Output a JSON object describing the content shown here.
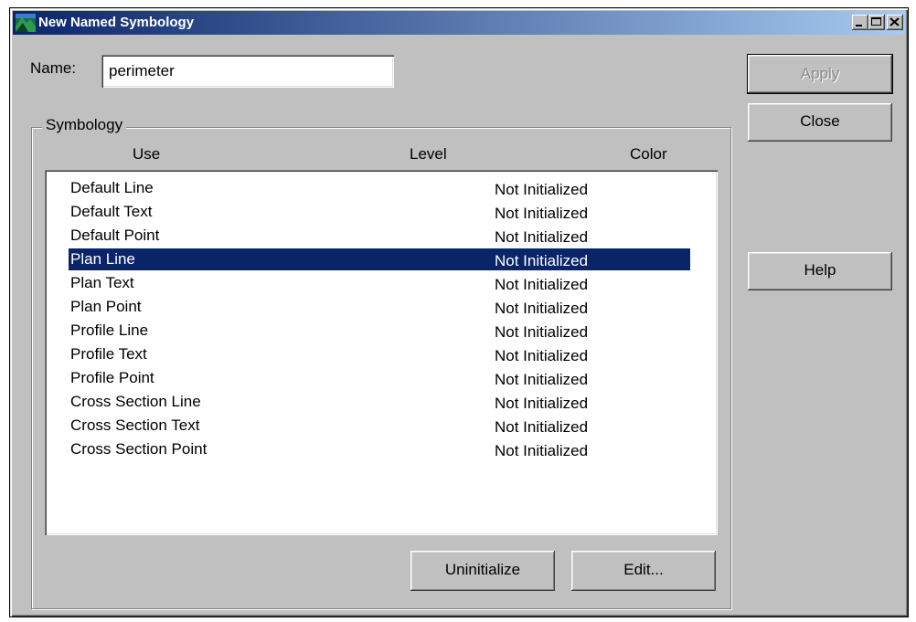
{
  "window": {
    "title": "New Named Symbology"
  },
  "name_field": {
    "label": "Name:",
    "value": "perimeter"
  },
  "buttons": {
    "apply": "Apply",
    "close": "Close",
    "help": "Help",
    "uninitialize": "Uninitialize",
    "edit": "Edit..."
  },
  "symbology": {
    "group_label": "Symbology",
    "columns": {
      "use": "Use",
      "level": "Level",
      "color": "Color"
    },
    "rows": [
      {
        "use": "Default Line",
        "level": "Not Initialized"
      },
      {
        "use": "Default Text",
        "level": "Not Initialized"
      },
      {
        "use": "Default Point",
        "level": "Not Initialized"
      },
      {
        "use": "Plan Line",
        "level": "Not Initialized",
        "selected": true
      },
      {
        "use": "Plan Text",
        "level": "Not Initialized"
      },
      {
        "use": "Plan Point",
        "level": "Not Initialized"
      },
      {
        "use": "Profile Line",
        "level": "Not Initialized"
      },
      {
        "use": "Profile Text",
        "level": "Not Initialized"
      },
      {
        "use": "Profile Point",
        "level": "Not Initialized"
      },
      {
        "use": "Cross Section Line",
        "level": "Not Initialized"
      },
      {
        "use": "Cross Section Text",
        "level": "Not Initialized"
      },
      {
        "use": "Cross Section Point",
        "level": "Not Initialized"
      }
    ]
  },
  "colors": {
    "titlebar_start": "#0a246a",
    "titlebar_end": "#a6caf0",
    "selection": "#0a246a",
    "face": "#c0c0c0"
  }
}
